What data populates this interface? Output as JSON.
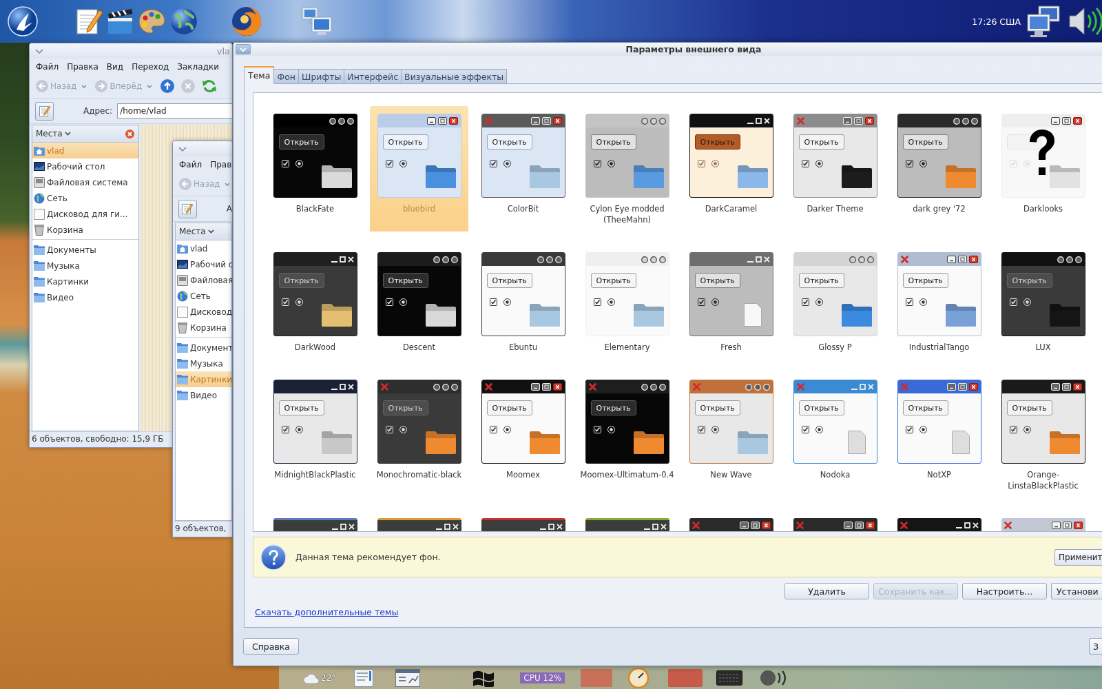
{
  "top_panel": {
    "clock": "17:26 США"
  },
  "file_windows": [
    {
      "title": "vla",
      "menu": [
        "Файл",
        "Правка",
        "Вид",
        "Переход",
        "Закладки"
      ],
      "toolbar": [
        {
          "kind": "back",
          "label": "Назад",
          "disabled": true
        },
        {
          "kind": "forward",
          "label": "Вперёд",
          "disabled": true
        },
        {
          "kind": "up",
          "disabled": false
        },
        {
          "kind": "stop",
          "disabled": true
        },
        {
          "kind": "reload",
          "disabled": false
        }
      ],
      "address": {
        "label": "Адрес:",
        "value": "/home/vlad"
      },
      "places": {
        "title": "Места",
        "closable": true,
        "devices": [
          {
            "kind": "home",
            "label": "vlad",
            "selected": true
          },
          {
            "kind": "desktop",
            "label": "Рабочий стол",
            "selected": false
          },
          {
            "kind": "filesystem",
            "label": "Файловая система",
            "selected": false
          },
          {
            "kind": "network",
            "label": "Сеть",
            "selected": false
          },
          {
            "kind": "drive",
            "label": "Дисковод для ги...",
            "selected": false
          },
          {
            "kind": "trash",
            "label": "Корзина",
            "selected": false
          }
        ],
        "bookmarks": [
          {
            "kind": "folder",
            "label": "Документы",
            "selected": false
          },
          {
            "kind": "folder",
            "label": "Музыка",
            "selected": false
          },
          {
            "kind": "folder",
            "label": "Картинки",
            "selected": false
          },
          {
            "kind": "folder",
            "label": "Видео",
            "selected": false
          }
        ]
      },
      "status": "6 объектов, свободно: 15,9 ГБ"
    },
    {
      "menu": [
        "Файл",
        "Прав"
      ],
      "toolbar": [
        {
          "kind": "back",
          "label": "Назад",
          "disabled": true
        }
      ],
      "address": {
        "label": "А"
      },
      "places": {
        "title": "Места",
        "closable": false,
        "devices": [
          {
            "kind": "home",
            "label": "vlad",
            "selected": false
          },
          {
            "kind": "desktop",
            "label": "Рабочий с",
            "selected": false
          },
          {
            "kind": "filesystem",
            "label": "Файловая",
            "selected": false
          },
          {
            "kind": "network",
            "label": "Сеть",
            "selected": false
          },
          {
            "kind": "drive",
            "label": "Дисковод",
            "selected": false
          },
          {
            "kind": "trash",
            "label": "Корзина",
            "selected": false
          }
        ],
        "bookmarks": [
          {
            "kind": "folder",
            "label": "Документ",
            "selected": false
          },
          {
            "kind": "folder",
            "label": "Музыка",
            "selected": false
          },
          {
            "kind": "folder",
            "label": "Картинки",
            "selected": true
          },
          {
            "kind": "folder",
            "label": "Видео",
            "selected": false
          }
        ]
      },
      "status": "9 объектов,"
    }
  ],
  "dialog": {
    "title": "Параметры внешнего вида",
    "tabs": [
      {
        "label": "Тема",
        "selected": true
      },
      {
        "label": "Фон",
        "selected": false
      },
      {
        "label": "Шрифты",
        "selected": false
      },
      {
        "label": "Интерфейс",
        "selected": false
      },
      {
        "label": "Визуальные эффекты",
        "selected": false
      }
    ],
    "themes": [
      {
        "name": "BlackFate",
        "selected": false,
        "kind": "black",
        "title_bar": {
          "color": "#000000",
          "kind": "circles"
        },
        "close_left": false,
        "button": "Открыть",
        "folder": {
          "kind": "folder",
          "color": "#dadada"
        }
      },
      {
        "name": "bluebird",
        "selected": true,
        "kind": "blue",
        "title_bar": {
          "color": "#b9cde9",
          "kind": "boxes"
        },
        "close_left": false,
        "button": "Открыть",
        "folder": {
          "kind": "folder",
          "color": "#4a90e0"
        }
      },
      {
        "name": "ColorBit",
        "selected": false,
        "kind": "blue",
        "title_bar": {
          "color": "#5a5a5a",
          "kind": "boxes"
        },
        "close_left": true,
        "button": "Открыть",
        "folder": {
          "kind": "folder",
          "color": "#a8c8e2"
        }
      },
      {
        "name": "Cylon Eye modded (TheeMahn)",
        "selected": false,
        "kind": "grey",
        "title_bar": {
          "color": "#c4c4c4",
          "kind": "circles"
        },
        "close_left": false,
        "button": "Открыть",
        "folder": {
          "kind": "folder",
          "color": "#5a9ae0"
        }
      },
      {
        "name": "DarkCaramel",
        "selected": false,
        "kind": "cream",
        "title_bar": {
          "color": "#111111",
          "kind": "glyphs"
        },
        "close_left": false,
        "button": "Открыть",
        "folder": {
          "kind": "folder",
          "color": "#8ab8e8"
        }
      },
      {
        "name": "Darker Theme",
        "selected": false,
        "kind": "light",
        "title_bar": {
          "color": "#8c8c8c",
          "kind": "boxes"
        },
        "close_left": true,
        "button": "Открыть",
        "folder": {
          "kind": "folder",
          "color": "#1c1c1c"
        }
      },
      {
        "name": "dark grey '72",
        "selected": false,
        "kind": "grey",
        "title_bar": {
          "color": "#2a2a2a",
          "kind": "circles"
        },
        "close_left": false,
        "button": "Открыть",
        "folder": {
          "kind": "folder",
          "color": "#f08a30"
        }
      },
      {
        "name": "Darklooks",
        "selected": false,
        "kind": "faded",
        "title_bar": {
          "color": "#eeeeee",
          "kind": "boxes"
        },
        "close_left": false,
        "folder": {
          "kind": "folder",
          "color": "#e2e2e2"
        }
      },
      {
        "name": "DarkWood",
        "selected": false,
        "kind": "dark",
        "title_bar": {
          "color": "#202020",
          "kind": "glyphs"
        },
        "close_left": false,
        "button": "Открыть",
        "folder": {
          "kind": "folder",
          "color": "#e2c070"
        }
      },
      {
        "name": "Descent",
        "selected": false,
        "kind": "black",
        "title_bar": {
          "color": "#1c1c1c",
          "kind": "circles"
        },
        "close_left": false,
        "button": "Открыть",
        "folder": {
          "kind": "folder",
          "color": "#d8d8d8"
        }
      },
      {
        "name": "Ebuntu",
        "selected": false,
        "kind": "white",
        "title_bar": {
          "color": "#3a3a3a",
          "kind": "circles"
        },
        "close_left": false,
        "button": "Открыть",
        "folder": {
          "kind": "folder",
          "color": "#a8c8e2"
        }
      },
      {
        "name": "Elementary",
        "selected": false,
        "kind": "white",
        "title_bar": {
          "color": "#efefef",
          "kind": "circles"
        },
        "close_left": false,
        "button": "Открыть",
        "folder": {
          "kind": "folder",
          "color": "#a8c8e2"
        }
      },
      {
        "name": "Fresh",
        "selected": false,
        "kind": "grey",
        "title_bar": {
          "color": "#6e6e6e",
          "kind": "glyphs"
        },
        "close_left": false,
        "button": "Открыть",
        "folder": {
          "kind": "document",
          "color": "#f8f8f8"
        }
      },
      {
        "name": "Glossy P",
        "selected": false,
        "kind": "light",
        "title_bar": {
          "color": "#d4d4d4",
          "kind": "circles"
        },
        "close_left": false,
        "button": "Открыть",
        "folder": {
          "kind": "folder",
          "color": "#3a8ae0"
        }
      },
      {
        "name": "IndustrialTango",
        "selected": false,
        "kind": "white",
        "title_bar": {
          "color": "#b0bcd2",
          "kind": "boxes"
        },
        "close_left": true,
        "button": "Открыть",
        "folder": {
          "kind": "folder",
          "color": "#7aa0d8"
        }
      },
      {
        "name": "LUX",
        "selected": false,
        "kind": "dark",
        "title_bar": {
          "color": "#111111",
          "kind": "circles"
        },
        "close_left": false,
        "button": "Открыть",
        "folder": {
          "kind": "folder",
          "color": "#151515"
        }
      },
      {
        "name": "MidnightBlackPlastic",
        "selected": false,
        "kind": "light",
        "title_bar": {
          "color": "#1a2035",
          "kind": "glyphs"
        },
        "close_left": false,
        "button": "Открыть",
        "folder": {
          "kind": "folder",
          "color": "#c8c8c8"
        }
      },
      {
        "name": "Monochromatic-black",
        "selected": false,
        "kind": "dark",
        "title_bar": {
          "color": "#2e2e2e",
          "kind": "circles"
        },
        "close_left": true,
        "button": "Открыть",
        "folder": {
          "kind": "folder",
          "color": "#f08a30"
        }
      },
      {
        "name": "Moomex",
        "selected": false,
        "kind": "white",
        "title_bar": {
          "color": "#111111",
          "kind": "boxes"
        },
        "close_left": true,
        "button": "Открыть",
        "folder": {
          "kind": "folder",
          "color": "#f08a30"
        }
      },
      {
        "name": "Moomex-Ultimatum-0.4",
        "selected": false,
        "kind": "black",
        "title_bar": {
          "color": "#1e1e1e",
          "kind": "circles"
        },
        "close_left": true,
        "button": "Открыть",
        "folder": {
          "kind": "folder",
          "color": "#f08a30"
        }
      },
      {
        "name": "New Wave",
        "selected": false,
        "kind": "light",
        "title_bar": {
          "color": "#c0703a",
          "kind": "circles"
        },
        "close_left": true,
        "button": "Открыть",
        "folder": {
          "kind": "folder",
          "color": "#a8c8e2"
        }
      },
      {
        "name": "Nodoka",
        "selected": false,
        "kind": "white",
        "title_bar": {
          "color": "#3a8ad4",
          "kind": "glyphs"
        },
        "close_left": true,
        "button": "Открыть",
        "folder": {
          "kind": "document",
          "color": "#dedede"
        }
      },
      {
        "name": "NotXP",
        "selected": false,
        "kind": "white",
        "title_bar": {
          "color": "#3a6ad8",
          "kind": "boxes"
        },
        "close_left": true,
        "button": "Открыть",
        "folder": {
          "kind": "document",
          "color": "#dedede"
        }
      },
      {
        "name": "Orange-LinstaBlackPlastic",
        "selected": false,
        "kind": "light",
        "title_bar": {
          "color": "#1a1a1a",
          "kind": "boxes"
        },
        "close_left": false,
        "button": "Открыть",
        "folder": {
          "kind": "folder",
          "color": "#f08a30"
        }
      },
      {
        "selected": false,
        "title_bar": {
          "color": "#3c3c3c",
          "kind": "glyphs",
          "edge": {
            "color": "#5a7ab8"
          }
        },
        "close_left": false
      },
      {
        "selected": false,
        "title_bar": {
          "color": "#3c3c3c",
          "kind": "glyphs",
          "edge": {
            "color": "#e09a30"
          }
        },
        "close_left": false
      },
      {
        "selected": false,
        "title_bar": {
          "color": "#3c3c3c",
          "kind": "glyphs",
          "edge": {
            "color": "#c83030"
          }
        },
        "close_left": false
      },
      {
        "selected": false,
        "title_bar": {
          "color": "#3c3c3c",
          "kind": "glyphs",
          "edge": {
            "color": "#80b030"
          }
        },
        "close_left": false
      },
      {
        "selected": false,
        "title_bar": {
          "color": "#2a2a2a",
          "kind": "boxes"
        },
        "close_left": true
      },
      {
        "selected": false,
        "title_bar": {
          "color": "#2a2a2a",
          "kind": "boxes"
        },
        "close_left": true
      },
      {
        "selected": false,
        "title_bar": {
          "color": "#151515",
          "kind": "glyphs"
        },
        "close_left": true
      },
      {
        "selected": false,
        "title_bar": {
          "color": "#c4c8d4",
          "kind": "boxes"
        },
        "close_left": true
      }
    ],
    "info": {
      "text": "Данная тема рекомендует фон.",
      "button": "Применит"
    },
    "buttons": [
      {
        "label": "Удалить",
        "disabled": false
      },
      {
        "label": "Сохранить как...",
        "disabled": true
      },
      {
        "label": "Настроить...",
        "disabled": false
      },
      {
        "label": "Установи",
        "disabled": false
      }
    ],
    "link": "Скачать дополнительные темы",
    "footer_buttons": [
      {
        "label": "Справка"
      },
      {
        "label": "З"
      }
    ]
  },
  "dock": {
    "weather": "22°",
    "cpu": "CPU 12%"
  }
}
